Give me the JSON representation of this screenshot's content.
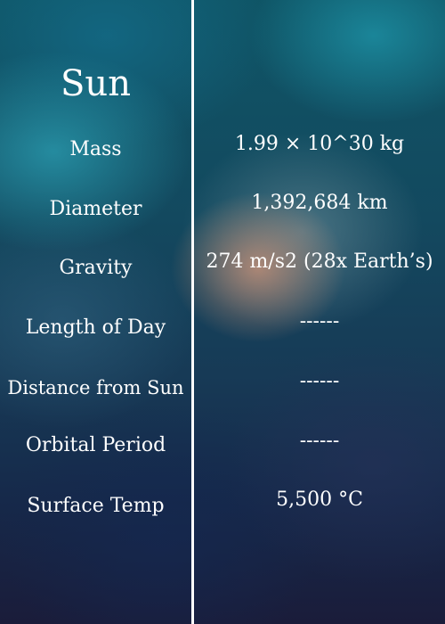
{
  "title": "Sun",
  "rows": [
    {
      "label": "Mass",
      "value": "1.99 × 10^30 kg"
    },
    {
      "label": "Diameter",
      "value": "1,392,684 km"
    },
    {
      "label": "Gravity",
      "value": "274 m/s2 (28x Earth’s)"
    },
    {
      "label": "Length of Day",
      "value": "------"
    },
    {
      "label": "Distance from Sun",
      "value": "------"
    },
    {
      "label": "Orbital Period",
      "value": "------"
    },
    {
      "label": "Surface Temp",
      "value": "5,500 °C"
    }
  ]
}
